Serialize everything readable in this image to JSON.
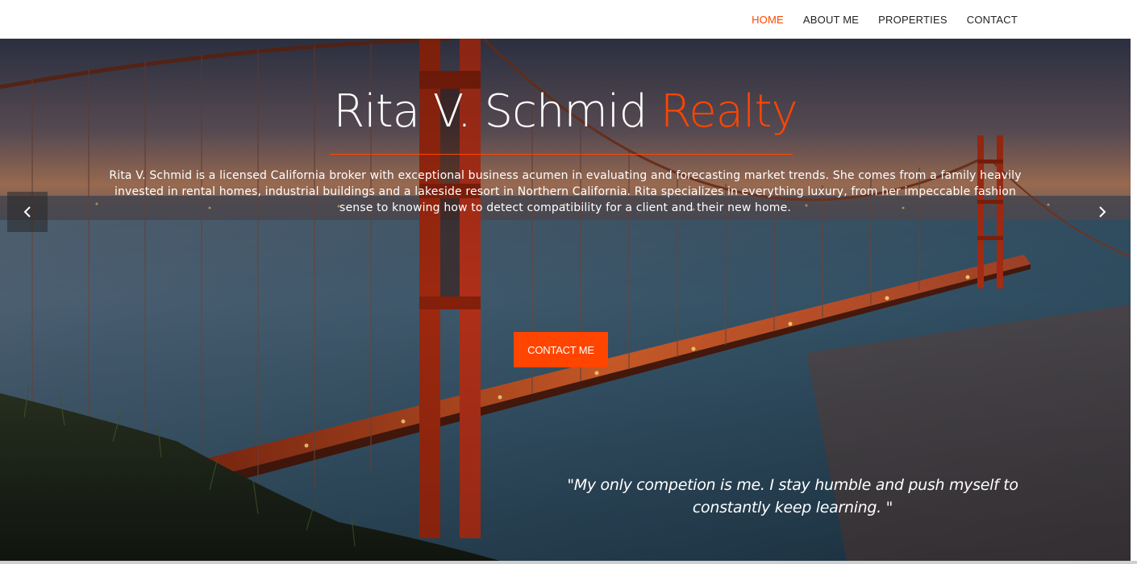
{
  "nav": {
    "items": [
      {
        "label": "HOME",
        "active": true
      },
      {
        "label": "ABOUT ME",
        "active": false
      },
      {
        "label": "PROPERTIES",
        "active": false
      },
      {
        "label": "CONTACT",
        "active": false
      }
    ]
  },
  "hero": {
    "title_main": "Rita V. Schmid ",
    "title_accent": "Realty",
    "description": "Rita V. Schmid is a licensed California broker with exceptional business acumen in evaluating and forecasting market trends. She comes from a family heavily invested in rental homes, industrial buildings and a lakeside resort in Northern California. Rita specializes in everything luxury, from her impeccable fashion sense to knowing how to detect compatibility for a client and their new home.",
    "cta_label": "CONTACT ME",
    "quote": "\"My only competion is me. I stay humble and push myself to constantly keep learning. \"",
    "prev_icon": "chevron-left-icon",
    "next_icon": "chevron-right-icon"
  },
  "colors": {
    "accent": "#ff4500",
    "nav_text": "#222222",
    "hero_text": "#ffffff"
  }
}
